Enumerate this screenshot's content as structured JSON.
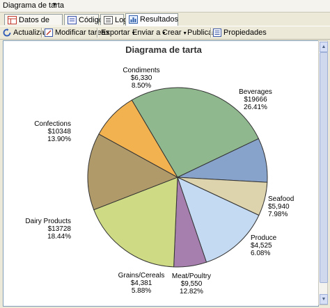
{
  "window": {
    "title": "Diagrama de tarta"
  },
  "tabs": [
    {
      "label": "Datos de entrada"
    },
    {
      "label": "Código"
    },
    {
      "label": "Log"
    },
    {
      "label": "Resultados"
    }
  ],
  "toolbar": {
    "refresh": "Actualizar",
    "modify": "Modificar tareas",
    "export": "Exportar",
    "send": "Enviar a",
    "create": "Crear",
    "publish": "Publicar",
    "properties": "Propiedades"
  },
  "colors": {
    "beverages": "#8fb88f",
    "seafood": "#87a3cc",
    "produce": "#ddd4ad",
    "meat": "#c4daf2",
    "grains": "#a67fae",
    "dairy": "#cfdb84",
    "confections": "#b09a69",
    "condiments": "#f2b24f"
  },
  "chart_data": {
    "type": "pie",
    "title": "Diagrama de tarta",
    "slices": [
      {
        "name": "Beverages",
        "value_label": "$19666",
        "pct_label": "26.41%",
        "value": 19666,
        "pct": 26.41
      },
      {
        "name": "Seafood",
        "value_label": "$5,940",
        "pct_label": "7.98%",
        "value": 5940,
        "pct": 7.98
      },
      {
        "name": "Produce",
        "value_label": "$4,525",
        "pct_label": "6.08%",
        "value": 4525,
        "pct": 6.08
      },
      {
        "name": "Meat/Poultry",
        "value_label": "$9,550",
        "pct_label": "12.82%",
        "value": 9550,
        "pct": 12.82
      },
      {
        "name": "Grains/Cereals",
        "value_label": "$4,381",
        "pct_label": "5.88%",
        "value": 4381,
        "pct": 5.88
      },
      {
        "name": "Dairy Products",
        "value_label": "$13728",
        "pct_label": "18.44%",
        "value": 13728,
        "pct": 18.44
      },
      {
        "name": "Confections",
        "value_label": "$10348",
        "pct_label": "13.90%",
        "value": 10348,
        "pct": 13.9
      },
      {
        "name": "Condiments",
        "value_label": "$6,330",
        "pct_label": "8.50%",
        "value": 6330,
        "pct": 8.5
      }
    ]
  }
}
